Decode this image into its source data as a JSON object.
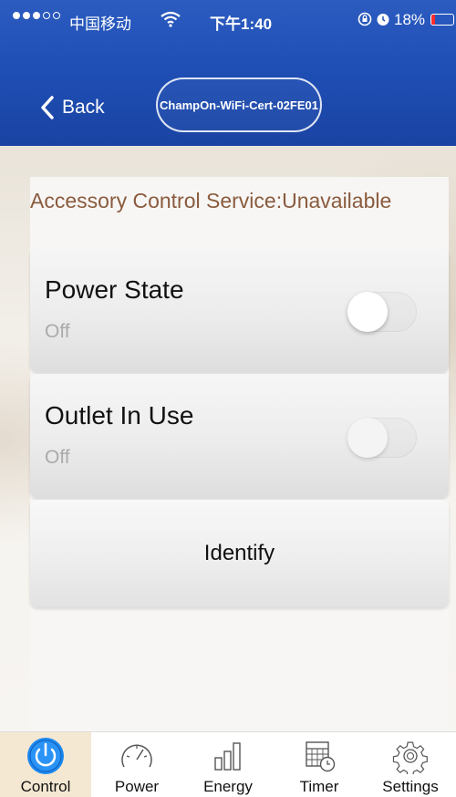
{
  "status_bar": {
    "carrier": "中国移动",
    "time": "下午1:40",
    "battery_percent": "18%",
    "battery_level": 0.18,
    "signal_bars_filled": 3,
    "signal_bars_total": 5
  },
  "nav": {
    "back_label": "Back",
    "device_name": "ChampOn-WiFi-Cert-02FE01"
  },
  "service": {
    "title": "Accessory Control Service:Unavailable"
  },
  "controls": {
    "power_state": {
      "label": "Power State",
      "value": "Off"
    },
    "outlet_in_use": {
      "label": "Outlet In Use",
      "value": "Off"
    },
    "identify_label": "Identify"
  },
  "tabs": [
    {
      "label": "Control",
      "icon": "power-icon",
      "active": true
    },
    {
      "label": "Power",
      "icon": "gauge-icon",
      "active": false
    },
    {
      "label": "Energy",
      "icon": "bar-chart-icon",
      "active": false
    },
    {
      "label": "Timer",
      "icon": "calendar-clock-icon",
      "active": false
    },
    {
      "label": "Settings",
      "icon": "gear-icon",
      "active": false
    }
  ],
  "colors": {
    "header_blue": "#1f4fb5",
    "accent_blue": "#1e88f0",
    "service_title": "#8a5b3e",
    "active_tab_bg": "#f4e8d3"
  }
}
